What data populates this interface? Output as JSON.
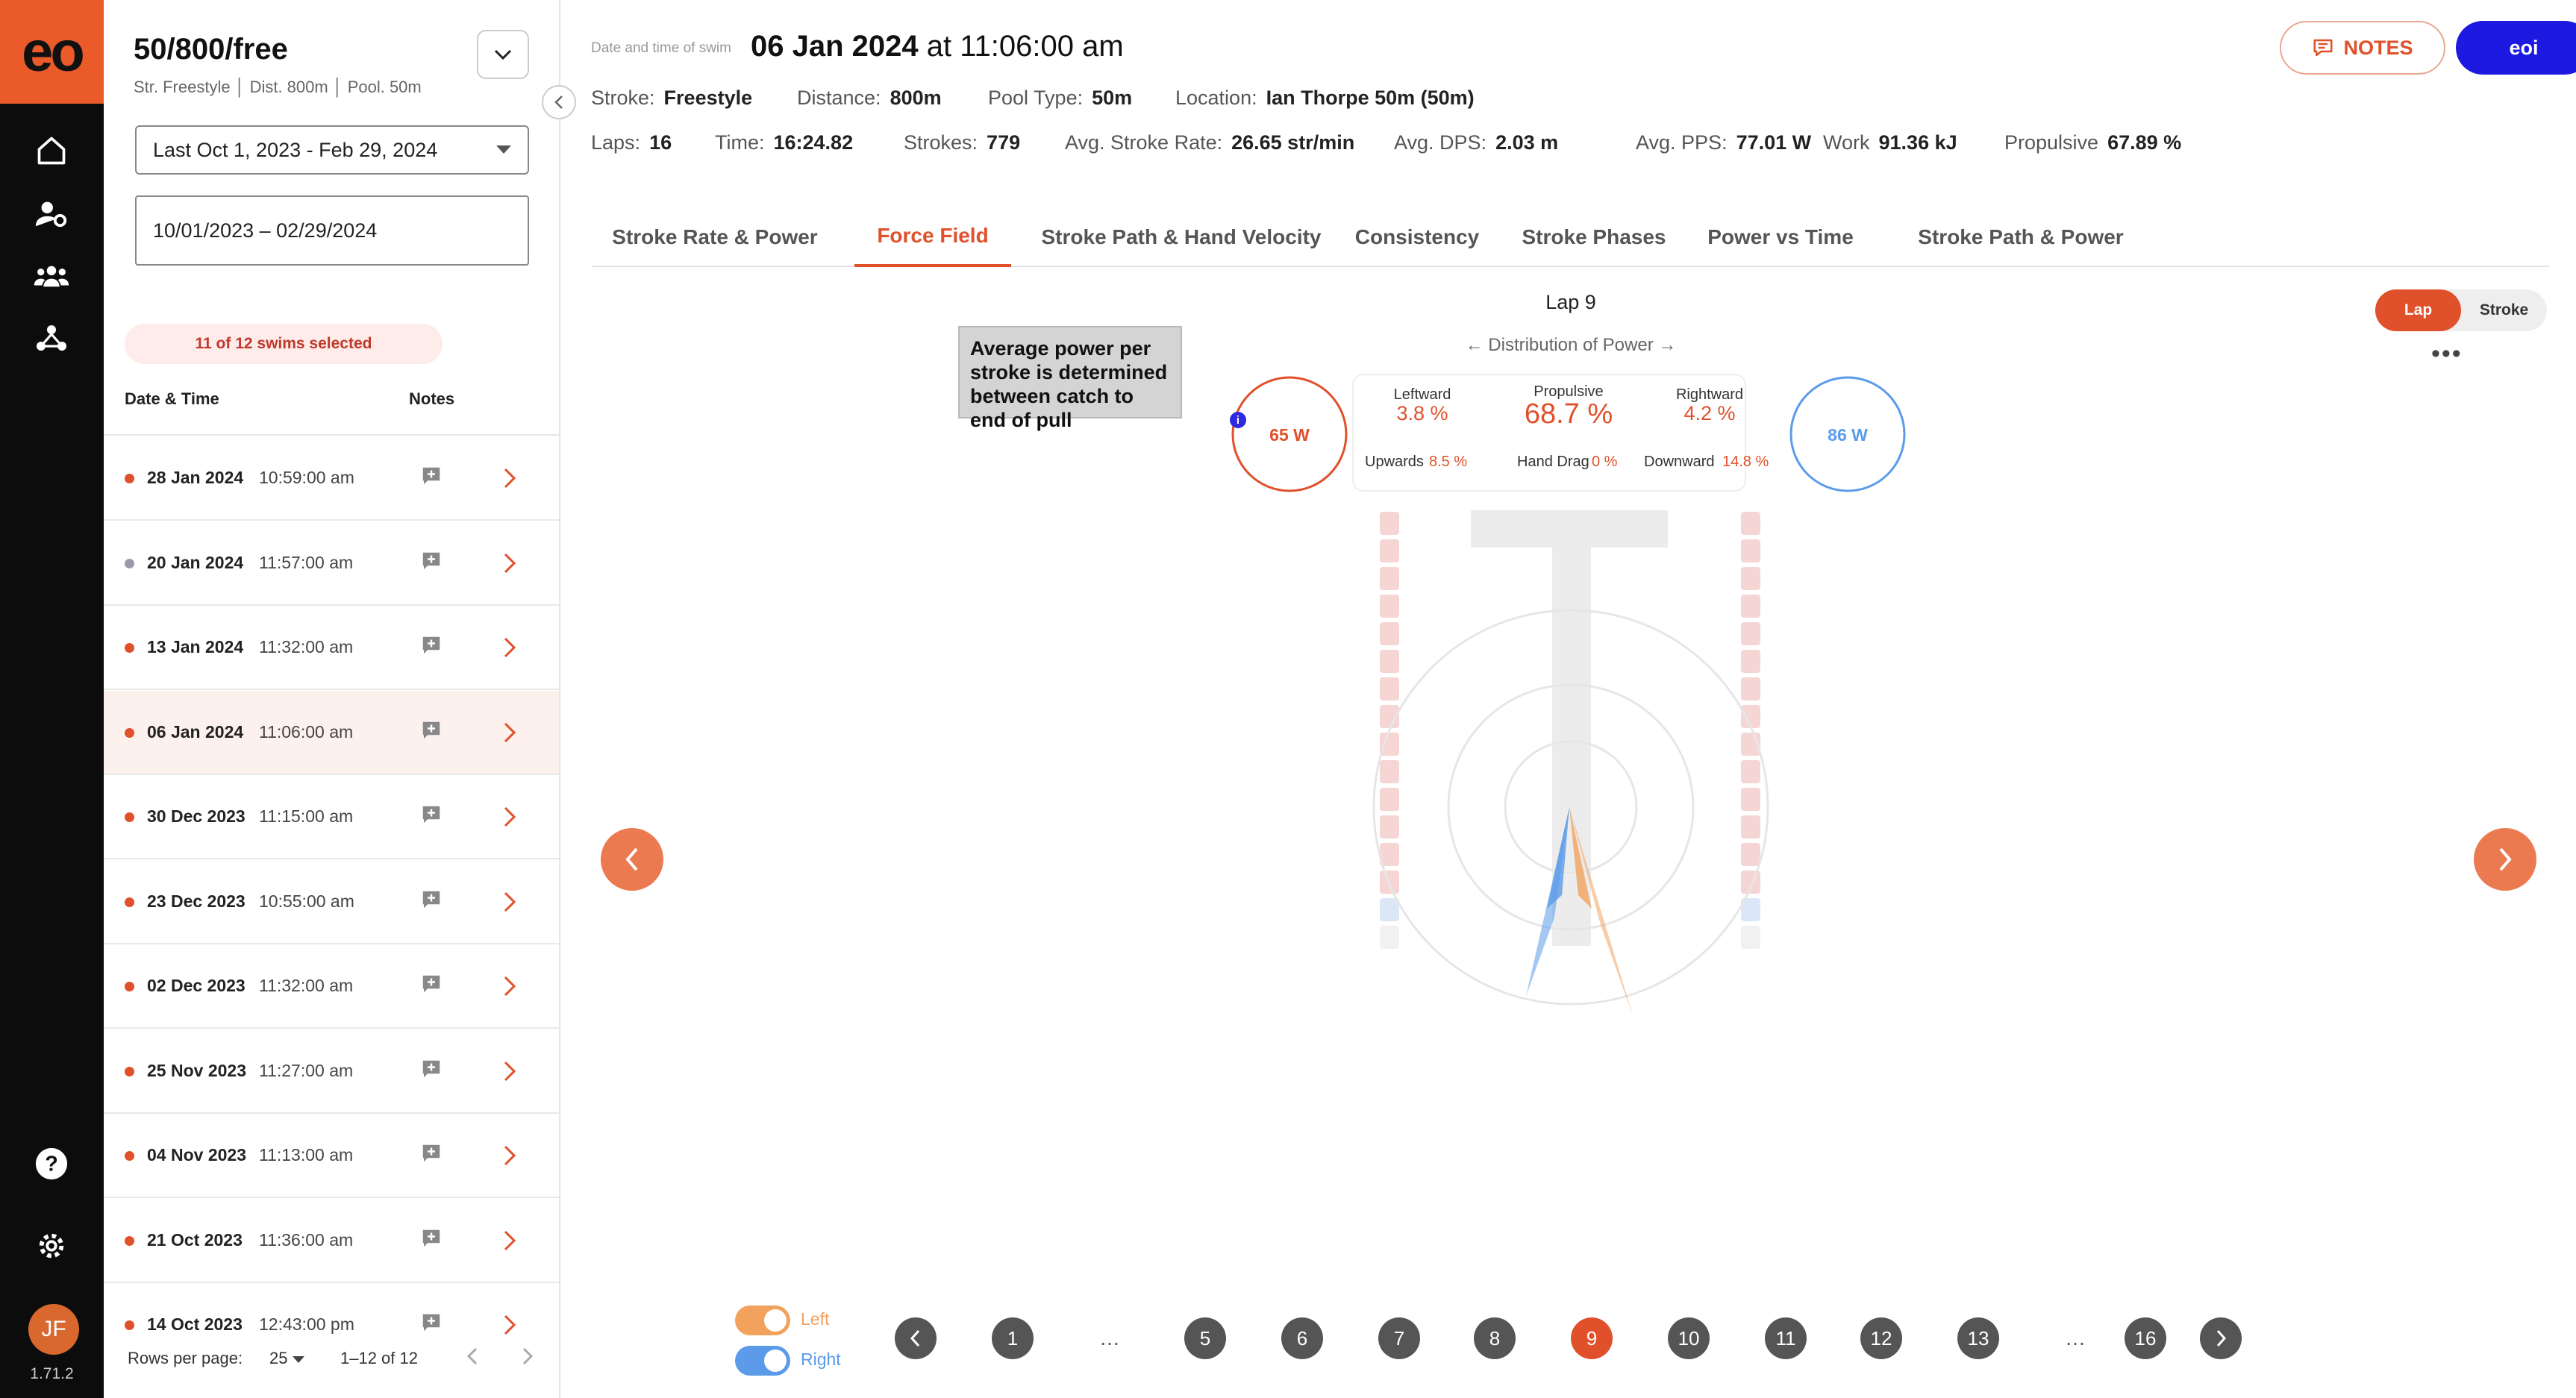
{
  "app": {
    "logo": "eo",
    "version": "1.71.2",
    "avatar_initials": "JF"
  },
  "list": {
    "title": "50/800/free",
    "subtitle": "Str. Freestyle │ Dist. 800m │ Pool. 50m",
    "range_select": "Last Oct 1, 2023 - Feb 29, 2024",
    "date_range": "10/01/2023 – 02/29/2024",
    "selected_badge": "11 of 12 swims selected",
    "col_date": "Date & Time",
    "col_notes": "Notes",
    "rows": [
      {
        "date": "28 Jan 2024",
        "time": "10:59:00 am",
        "dot": "#e0502a"
      },
      {
        "date": "20 Jan 2024",
        "time": "11:57:00 am",
        "dot": "#9a9aa8"
      },
      {
        "date": "13 Jan 2024",
        "time": "11:32:00 am",
        "dot": "#e0502a"
      },
      {
        "date": "06 Jan 2024",
        "time": "11:06:00 am",
        "dot": "#e0502a"
      },
      {
        "date": "30 Dec 2023",
        "time": "11:15:00 am",
        "dot": "#e0502a"
      },
      {
        "date": "23 Dec 2023",
        "time": "10:55:00 am",
        "dot": "#e0502a"
      },
      {
        "date": "02 Dec 2023",
        "time": "11:32:00 am",
        "dot": "#e0502a"
      },
      {
        "date": "25 Nov 2023",
        "time": "11:27:00 am",
        "dot": "#e0502a"
      },
      {
        "date": "04 Nov 2023",
        "time": "11:13:00 am",
        "dot": "#e0502a"
      },
      {
        "date": "21 Oct 2023",
        "time": "11:36:00 am",
        "dot": "#e0502a"
      },
      {
        "date": "14 Oct 2023",
        "time": "12:43:00 pm",
        "dot": "#e0502a"
      }
    ],
    "rows_per_page_label": "Rows per page:",
    "rows_per_page": "25",
    "page_range": "1–12 of 12"
  },
  "header": {
    "caption": "Date and time of swim",
    "date": "06 Jan 2024",
    "at": "at 11:06:00 am",
    "stats1": [
      {
        "label": "Stroke:",
        "value": "Freestyle"
      },
      {
        "label": "Distance:",
        "value": "800m"
      },
      {
        "label": "Pool Type:",
        "value": "50m"
      },
      {
        "label": "Location:",
        "value": "Ian Thorpe 50m (50m)"
      }
    ],
    "stats2": [
      {
        "label": "Laps:",
        "value": "16"
      },
      {
        "label": "Time:",
        "value": "16:24.82"
      },
      {
        "label": "Strokes:",
        "value": "779"
      },
      {
        "label": "Avg. Stroke Rate:",
        "value": "26.65 str/min"
      },
      {
        "label": "Avg. DPS:",
        "value": "2.03 m"
      },
      {
        "label": "Avg. PPS:",
        "value": "77.01 W"
      },
      {
        "label": "Work",
        "value": "91.36 kJ"
      },
      {
        "label": "Propulsive",
        "value": "67.89 %"
      }
    ],
    "notes_label": "NOTES",
    "user_label": "eoi"
  },
  "tabs": [
    "Stroke Rate & Power",
    "Force Field",
    "Stroke Path & Hand Velocity",
    "Consistency",
    "Stroke Phases",
    "Power vs Time",
    "Stroke Path & Power"
  ],
  "field": {
    "lap_title": "Lap 9",
    "dist_label": "← Distribution of Power →",
    "tooltip": "Average power per stroke is determined between catch to end of pull",
    "left_power": "65 W",
    "right_power": "86 W",
    "leftward_label": "Leftward",
    "leftward": "3.8 %",
    "propulsive_label": "Propulsive",
    "propulsive": "68.7 %",
    "rightward_label": "Rightward",
    "rightward": "4.2 %",
    "upwards_label": "Upwards",
    "upwards": "8.5 %",
    "handdrag_label": "Hand Drag",
    "handdrag": "0 %",
    "downward_label": "Downward",
    "downward": "14.8 %",
    "toggle_lap": "Lap",
    "toggle_stroke": "Stroke",
    "left_label": "Left",
    "right_label": "Right",
    "laps": [
      "1",
      "…",
      "5",
      "6",
      "7",
      "8",
      "9",
      "10",
      "11",
      "12",
      "13",
      "…",
      "16"
    ],
    "current_lap": "9",
    "colors": {
      "accent": "#e0502a",
      "left": "#f3a25e",
      "right": "#5b9bea",
      "brand_blue": "#1d19e0"
    }
  }
}
